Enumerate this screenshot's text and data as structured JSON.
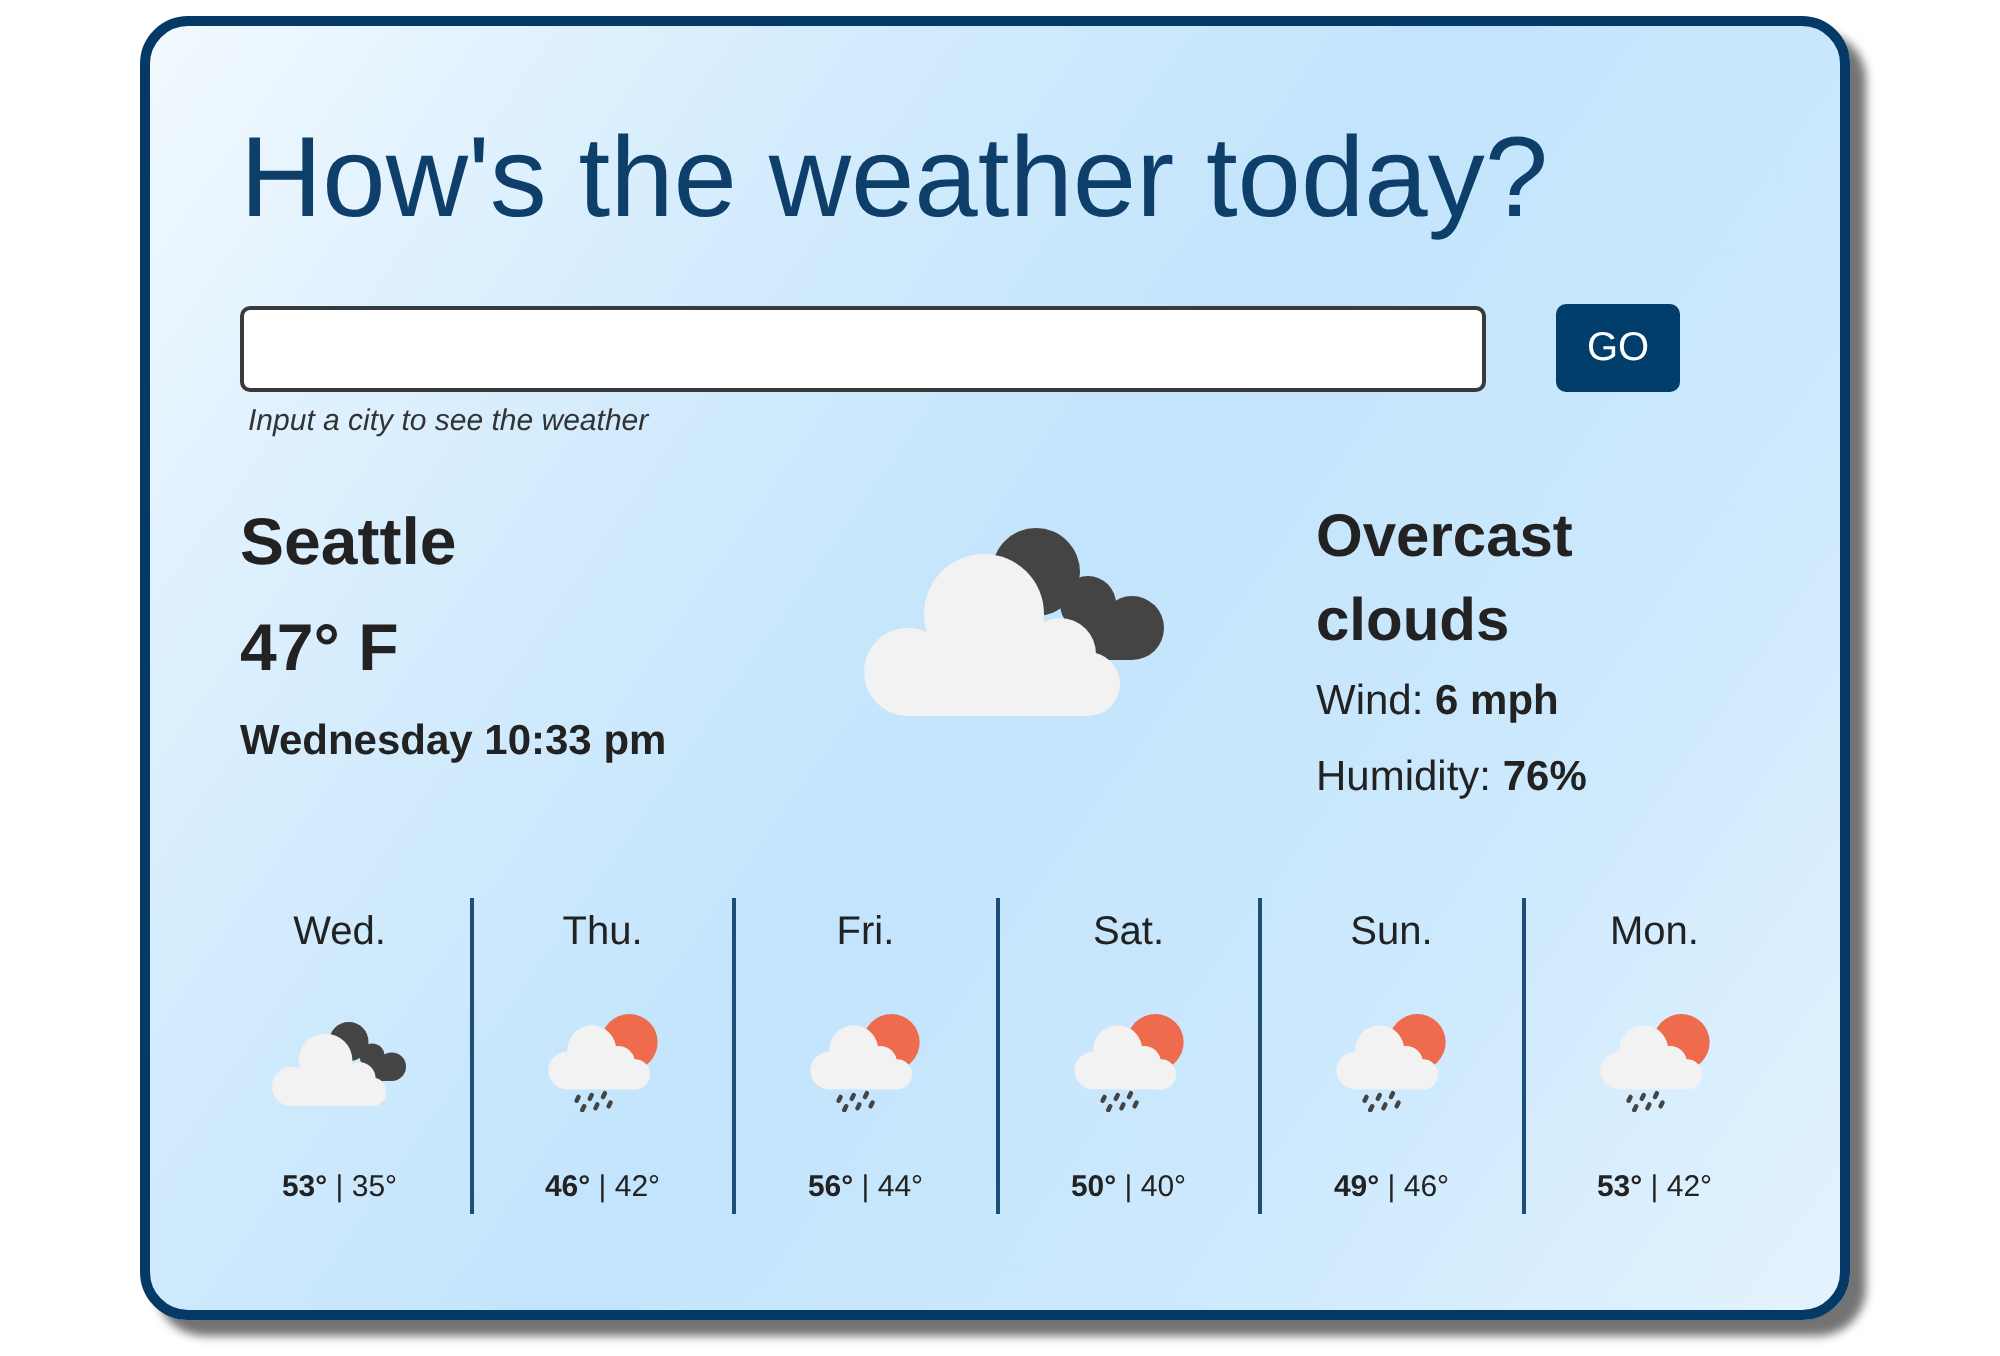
{
  "title": "How's the weather today?",
  "search": {
    "hint": "Input a city to see the weather",
    "button": "GO"
  },
  "current": {
    "city": "Seattle",
    "temperature": "47° F",
    "datetime": "Wednesday 10:33 pm",
    "kind": "overcast",
    "condition": "Overcast clouds",
    "details": [
      "Wind: **6 mph**",
      "Humidity: **76%**"
    ]
  },
  "forecast": [
    {
      "day": "Wed.",
      "kind": "overcast",
      "temps": "**53°** | 35°"
    },
    {
      "day": "Thu.",
      "kind": "rain",
      "temps": "**46°** | 42°"
    },
    {
      "day": "Fri.",
      "kind": "rain",
      "temps": "**56°** | 44°"
    },
    {
      "day": "Sat.",
      "kind": "rain",
      "temps": "**50°** | 40°"
    },
    {
      "day": "Sun.",
      "kind": "rain",
      "temps": "**49°** | 46°"
    },
    {
      "day": "Mon.",
      "kind": "rain",
      "temps": "**53°** | 42°"
    }
  ]
}
